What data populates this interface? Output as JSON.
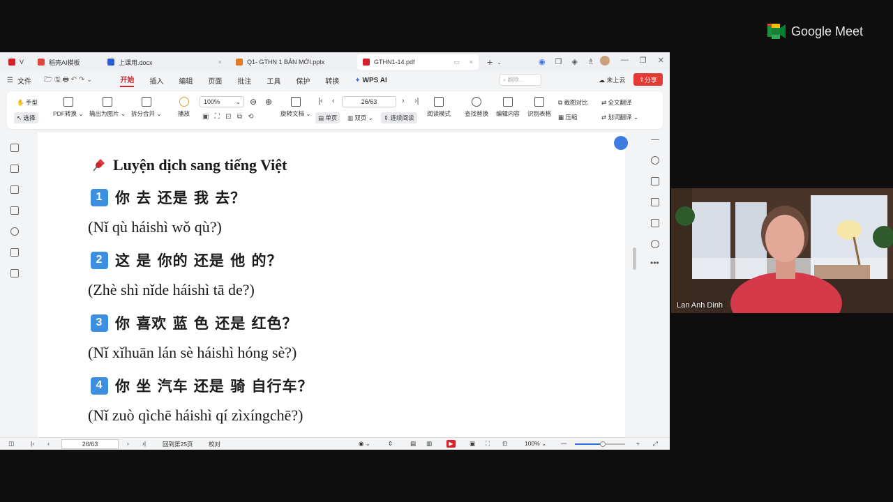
{
  "meet": {
    "brand": "Google Meet",
    "participant_name": "Lan Anh Dinh"
  },
  "tabs": [
    {
      "label": "V",
      "color": "#d6202a"
    },
    {
      "label": "稻壳AI模板",
      "color": "#e0463c"
    },
    {
      "label": "上课用.docx",
      "color": "#2b5cd6"
    },
    {
      "label": "Q1- GTHN 1 BẢN MỚI.pptx",
      "color": "#e07b24"
    },
    {
      "label": "GTHN1-14.pdf",
      "color": "#d6202a"
    }
  ],
  "menu": {
    "file": "文件",
    "items": [
      "开始",
      "插入",
      "编辑",
      "页面",
      "批注",
      "工具",
      "保护",
      "转换"
    ],
    "wps_ai": "WPS AI",
    "search_placeholder": "剧除...",
    "cloud": "未上云",
    "share": "分享"
  },
  "toolbar": {
    "hand": "手型",
    "select": "选择",
    "pdf_convert": "PDF转换",
    "export_image": "输出为图片",
    "split_merge": "拆分合并",
    "play": "播放",
    "zoom": "100%",
    "rotate": "旋转文档",
    "page": "26/63",
    "single": "单页",
    "double": "双页",
    "continuous": "连续阅读",
    "read_mode": "阅读模式",
    "find_replace": "查找替换",
    "edit_content": "编辑内容",
    "recognize_table": "识别表格",
    "screenshot_compare": "截图对比",
    "compress": "压缩",
    "full_translate": "全文翻译",
    "word_translate": "划词翻译"
  },
  "document": {
    "heading": "Luyện dịch sang tiếng Việt",
    "items": [
      {
        "num": "1",
        "hanzi": "你 去 还是 我 去？",
        "pinyin": "(Nǐ qù háishì wǒ qù?)"
      },
      {
        "num": "2",
        "hanzi": "这 是 你的 还是 他 的？",
        "pinyin": "(Zhè shì nǐde háishì tā de?)"
      },
      {
        "num": "3",
        "hanzi": "你 喜欢 蓝 色 还是 红色？",
        "pinyin": "(Nǐ xǐhuān lán sè háishì hóng sè?)"
      },
      {
        "num": "4",
        "hanzi": "你 坐 汽车 还是 骑 自行车？",
        "pinyin": "(Nǐ zuò qìchē háishì qí zìxíngchē?)"
      }
    ]
  },
  "status": {
    "page": "26/63",
    "back_to": "回到第25页",
    "proof": "校对",
    "zoom": "100%",
    "zoom_level": 0.55
  }
}
